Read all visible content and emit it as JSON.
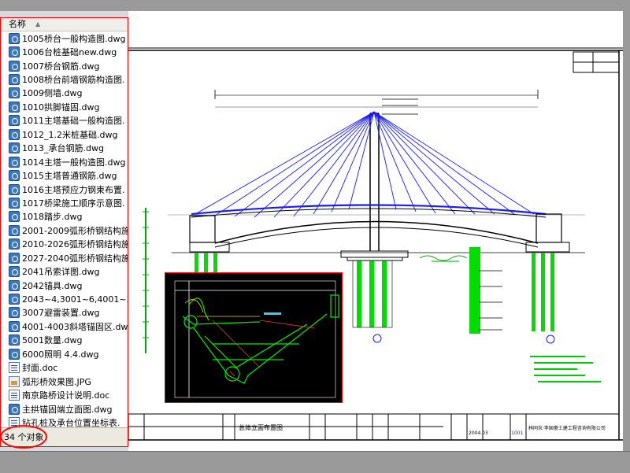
{
  "file_list": {
    "header_label": "名称",
    "items": [
      {
        "name": "1005桥台一般构造图.dwg",
        "icon": "dwg-file-icon"
      },
      {
        "name": "1006台桩基础new.dwg",
        "icon": "dwg-file-icon"
      },
      {
        "name": "1007桥台钢筋.dwg",
        "icon": "dwg-file-icon"
      },
      {
        "name": "1008桥台前墙钢筋构造图.",
        "icon": "dwg-file-icon"
      },
      {
        "name": "1009侧墙.dwg",
        "icon": "dwg-file-icon"
      },
      {
        "name": "1010拱脚锚固.dwg",
        "icon": "dwg-file-icon"
      },
      {
        "name": "1011主塔基础一般构造图.",
        "icon": "dwg-file-icon"
      },
      {
        "name": "1012_1.2米桩基础.dwg",
        "icon": "dwg-file-icon"
      },
      {
        "name": "1013_承台钢筋.dwg",
        "icon": "dwg-file-icon"
      },
      {
        "name": "1014主塔一般构造图.dwg",
        "icon": "dwg-file-icon"
      },
      {
        "name": "1015主塔普通钢筋.dwg",
        "icon": "dwg-file-icon"
      },
      {
        "name": "1016主塔预应力钢束布置.",
        "icon": "dwg-file-icon"
      },
      {
        "name": "1017桥梁施工顺序示意图.",
        "icon": "dwg-file-icon"
      },
      {
        "name": "1018踏步.dwg",
        "icon": "dwg-file-icon"
      },
      {
        "name": "2001-2009弧形桥钢结构施",
        "icon": "dwg-file-icon"
      },
      {
        "name": "2010-2026弧形桥钢结构施",
        "icon": "dwg-file-icon"
      },
      {
        "name": "2027-2040弧形桥钢结构施",
        "icon": "dwg-file-icon"
      },
      {
        "name": "2041吊索详图.dwg",
        "icon": "dwg-file-icon"
      },
      {
        "name": "2042锚具.dwg",
        "icon": "dwg-file-icon"
      },
      {
        "name": "2043~4,3001~6,4001~3弧.",
        "icon": "dwg-file-icon"
      },
      {
        "name": "3007避雷装置.dwg",
        "icon": "dwg-file-icon"
      },
      {
        "name": "4001-4003斜塔锚固区.dwg",
        "icon": "dwg-file-icon"
      },
      {
        "name": "5001数量.dwg",
        "icon": "dwg-file-icon"
      },
      {
        "name": "6000照明 4.4.dwg",
        "icon": "dwg-file-icon"
      },
      {
        "name": "封面.doc",
        "icon": "doc-file-icon"
      },
      {
        "name": "弧形桥效果图.JPG",
        "icon": "jpg-file-icon"
      },
      {
        "name": "南京路桥设计说明.doc",
        "icon": "doc-file-icon"
      },
      {
        "name": "主拱锚固端立面图.dwg",
        "icon": "dwg-file-icon"
      },
      {
        "name": "钻孔桩及承台位置坐标表.",
        "icon": "doc-file-icon"
      }
    ]
  },
  "status_bar": {
    "count_text": "34 个对象"
  },
  "drawing": {
    "title_block": {
      "drawing_name": "总体立面布置图",
      "date": "2004.03",
      "sheet_no": "1001",
      "company": "林同炎·李国豪土建工程咨询有限公司"
    },
    "colors": {
      "cable": "#1a1aff",
      "pile": "#00dd00",
      "dimension": "#333333",
      "water": "#00aa00",
      "highlight": "#ff0000"
    }
  }
}
